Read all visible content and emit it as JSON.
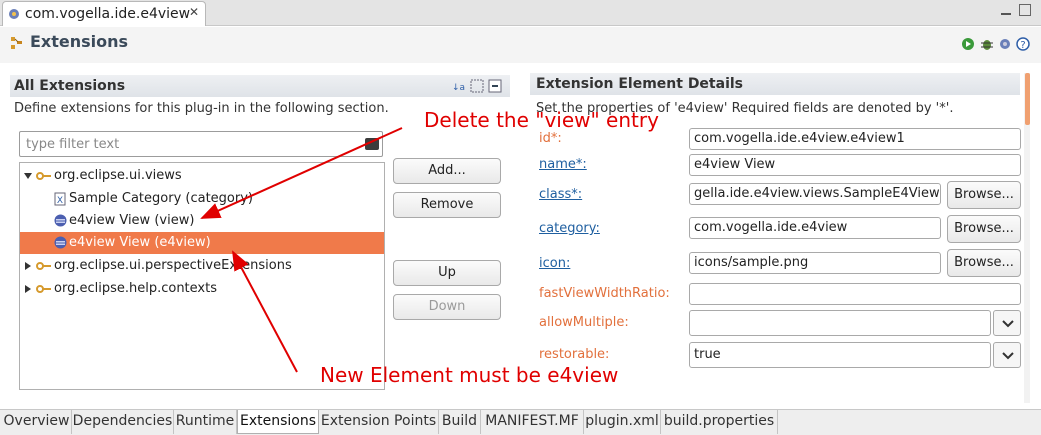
{
  "editor": {
    "tab_label": "com.vogella.ide.e4view",
    "close_glyph": "✕"
  },
  "form": {
    "title": "Extensions"
  },
  "all_extensions": {
    "title": "All Extensions",
    "description": "Define extensions for this plug-in in the following section.",
    "filter_placeholder": "type filter text",
    "tree": [
      {
        "label": "org.eclipse.ui.views",
        "icon": "extension-icon",
        "expanded": true
      },
      {
        "label": "Sample Category (category)",
        "icon": "category-icon"
      },
      {
        "label": "e4view View (view)",
        "icon": "element-icon"
      },
      {
        "label": "e4view View (e4view)",
        "icon": "element-icon",
        "selected": true
      },
      {
        "label": "org.eclipse.ui.perspectiveExtensions",
        "icon": "extension-icon",
        "expanded": false
      },
      {
        "label": "org.eclipse.help.contexts",
        "icon": "extension-icon",
        "expanded": false
      }
    ],
    "buttons": {
      "add": "Add...",
      "remove": "Remove",
      "up": "Up",
      "down": "Down"
    }
  },
  "details": {
    "title": "Extension Element Details",
    "description": "Set the properties of 'e4view' Required fields are denoted by '*'.",
    "fields": {
      "id": {
        "label": "id*:",
        "value": "com.vogella.ide.e4view.e4view1"
      },
      "name": {
        "label": "name*:",
        "value": "e4view View"
      },
      "class": {
        "label": "class*:",
        "value": "gella.ide.e4view.views.SampleE4View"
      },
      "category": {
        "label": "category:",
        "value": "com.vogella.ide.e4view"
      },
      "icon": {
        "label": "icon:",
        "value": "icons/sample.png"
      },
      "fastViewWidthRatio": {
        "label": "fastViewWidthRatio:",
        "value": ""
      },
      "allowMultiple": {
        "label": "allowMultiple:",
        "value": ""
      },
      "restorable": {
        "label": "restorable:",
        "value": "true"
      }
    },
    "browse_label": "Browse..."
  },
  "bottom_tabs": [
    {
      "label": "Overview"
    },
    {
      "label": "Dependencies"
    },
    {
      "label": "Runtime"
    },
    {
      "label": "Extensions",
      "active": true
    },
    {
      "label": "Extension Points"
    },
    {
      "label": "Build"
    },
    {
      "label": "MANIFEST.MF"
    },
    {
      "label": "plugin.xml"
    },
    {
      "label": "build.properties"
    }
  ],
  "annotations": {
    "top": "Delete the \"view\" entry",
    "bottom": "New Element must be e4view"
  },
  "colors": {
    "selection": "#f07a4a",
    "annotation": "#e00000",
    "required_label": "#e2703c",
    "link_label": "#1f5fa0"
  }
}
